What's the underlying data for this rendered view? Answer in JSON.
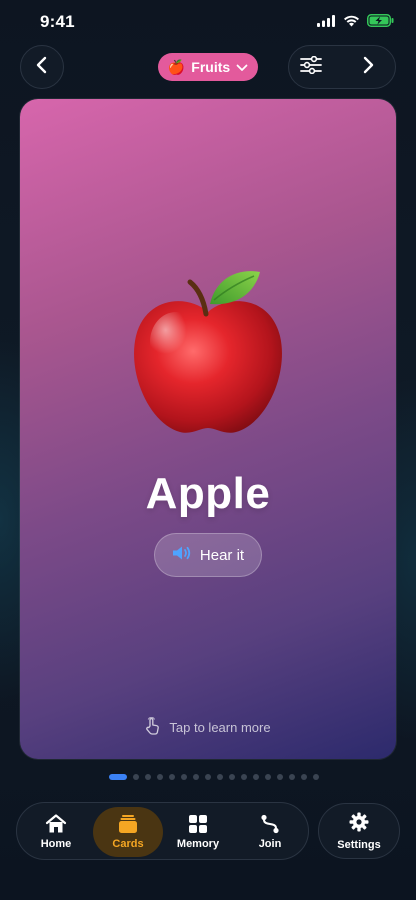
{
  "status_bar": {
    "time": "9:41"
  },
  "header": {
    "category_label": "Fruits",
    "category_emoji": "🍎",
    "icons": [
      "chevron-left-icon",
      "sliders-icon",
      "chevron-right-icon",
      "chevron-down-icon"
    ]
  },
  "card": {
    "word": "Apple",
    "hear_label": "Hear it",
    "tap_hint": "Tap to learn more",
    "accent_colors": {
      "chip": "#e35a9c",
      "speaker": "#4fa3ff"
    }
  },
  "pagination": {
    "current": 1,
    "total": 17,
    "active_color": "#3b82f6"
  },
  "bottom_nav": {
    "items": [
      {
        "label": "Home",
        "icon": "home-icon"
      },
      {
        "label": "Cards",
        "icon": "cards-icon",
        "active": true
      },
      {
        "label": "Memory",
        "icon": "grid-icon"
      },
      {
        "label": "Join",
        "icon": "connect-icon"
      }
    ],
    "settings": {
      "label": "Settings",
      "icon": "gear-icon"
    },
    "active_color": "#f5a623"
  }
}
